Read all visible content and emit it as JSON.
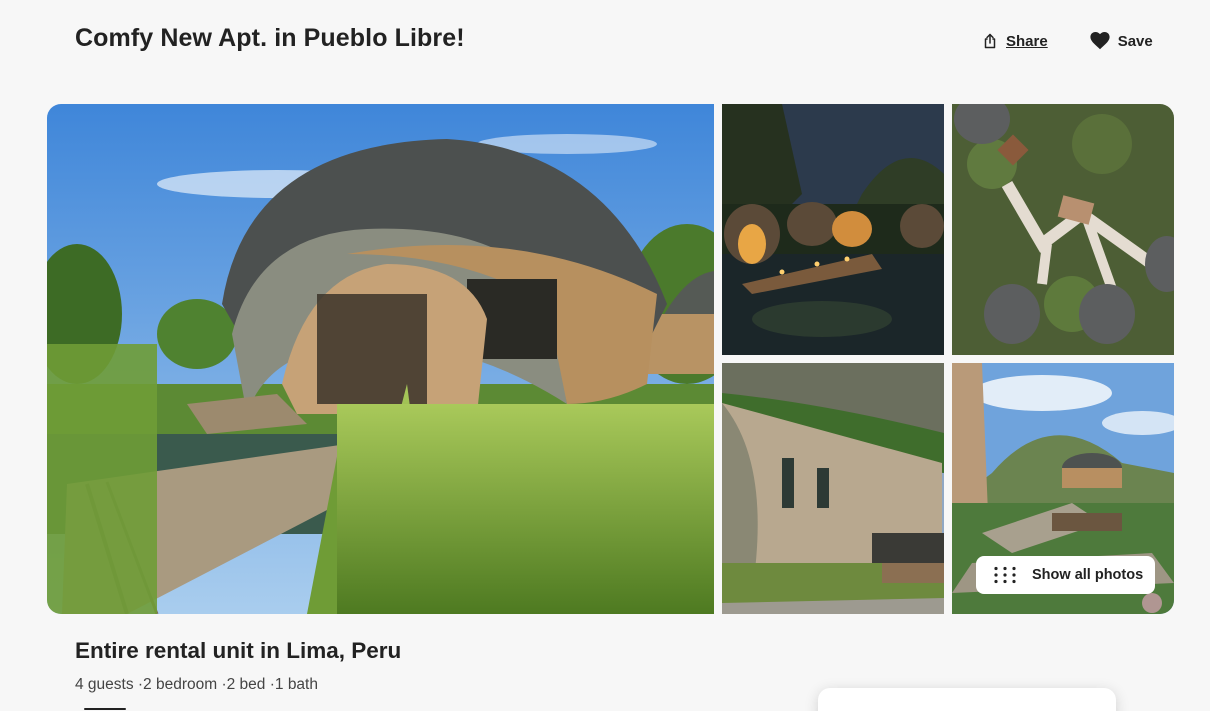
{
  "listing": {
    "title": "Comfy New Apt. in Pueblo Libre!",
    "subtitle": "Entire rental unit in Lima, Peru",
    "details": "4 guests ·2 bedroom ·2 bed ·1 bath"
  },
  "actions": {
    "share_label": "Share",
    "share_icon": "share-icon",
    "save_label": "Save",
    "save_icon": "heart-icon"
  },
  "gallery": {
    "show_all_label": "Show all photos",
    "show_all_icon": "grid-dots-icon",
    "photos": [
      "dome-cabin-on-boardwalk",
      "cabins-lit-at-dusk",
      "aerial-view-of-cabins",
      "bamboo-fence-walkway",
      "resort-overview"
    ]
  },
  "colors": {
    "background": "#f7f7f7",
    "text": "#222222",
    "secondary_text": "#444444"
  }
}
